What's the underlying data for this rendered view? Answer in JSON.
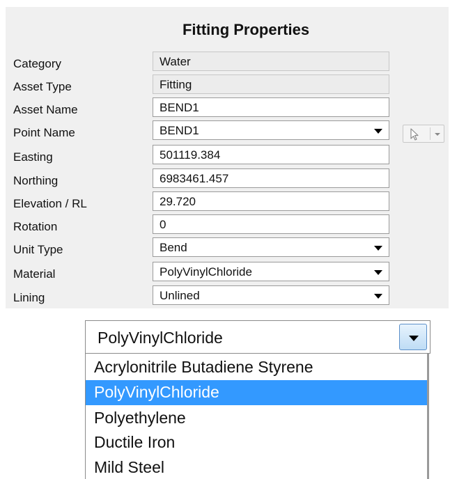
{
  "panel": {
    "title": "Fitting Properties",
    "rows": [
      {
        "label": "Category",
        "value": "Water",
        "kind": "readonly"
      },
      {
        "label": "Asset Type",
        "value": "Fitting",
        "kind": "readonly"
      },
      {
        "label": "Asset Name",
        "value": "BEND1",
        "kind": "text"
      },
      {
        "label": "Point Name",
        "value": "BEND1",
        "kind": "dropdown"
      },
      {
        "label": "Easting",
        "value": "501119.384",
        "kind": "text"
      },
      {
        "label": "Northing",
        "value": "6983461.457",
        "kind": "text"
      },
      {
        "label": "Elevation / RL",
        "value": "29.720",
        "kind": "text"
      },
      {
        "label": "Rotation",
        "value": "0",
        "kind": "text"
      },
      {
        "label": "Unit Type",
        "value": "Bend",
        "kind": "dropdown"
      },
      {
        "label": "Material",
        "value": "PolyVinylChloride",
        "kind": "dropdown"
      },
      {
        "label": "Lining",
        "value": "Unlined",
        "kind": "dropdown"
      }
    ],
    "point_picker": {
      "icon": "cursor-arrow-icon"
    }
  },
  "material_dropdown": {
    "value": "PolyVinylChloride",
    "options": [
      "Acrylonitrile Butadiene Styrene",
      "PolyVinylChloride",
      "Polyethylene",
      "Ductile Iron",
      "Mild Steel"
    ],
    "selected_index": 1,
    "colors": {
      "highlight": "#3399ff",
      "highlight_text": "#ffffff"
    }
  }
}
